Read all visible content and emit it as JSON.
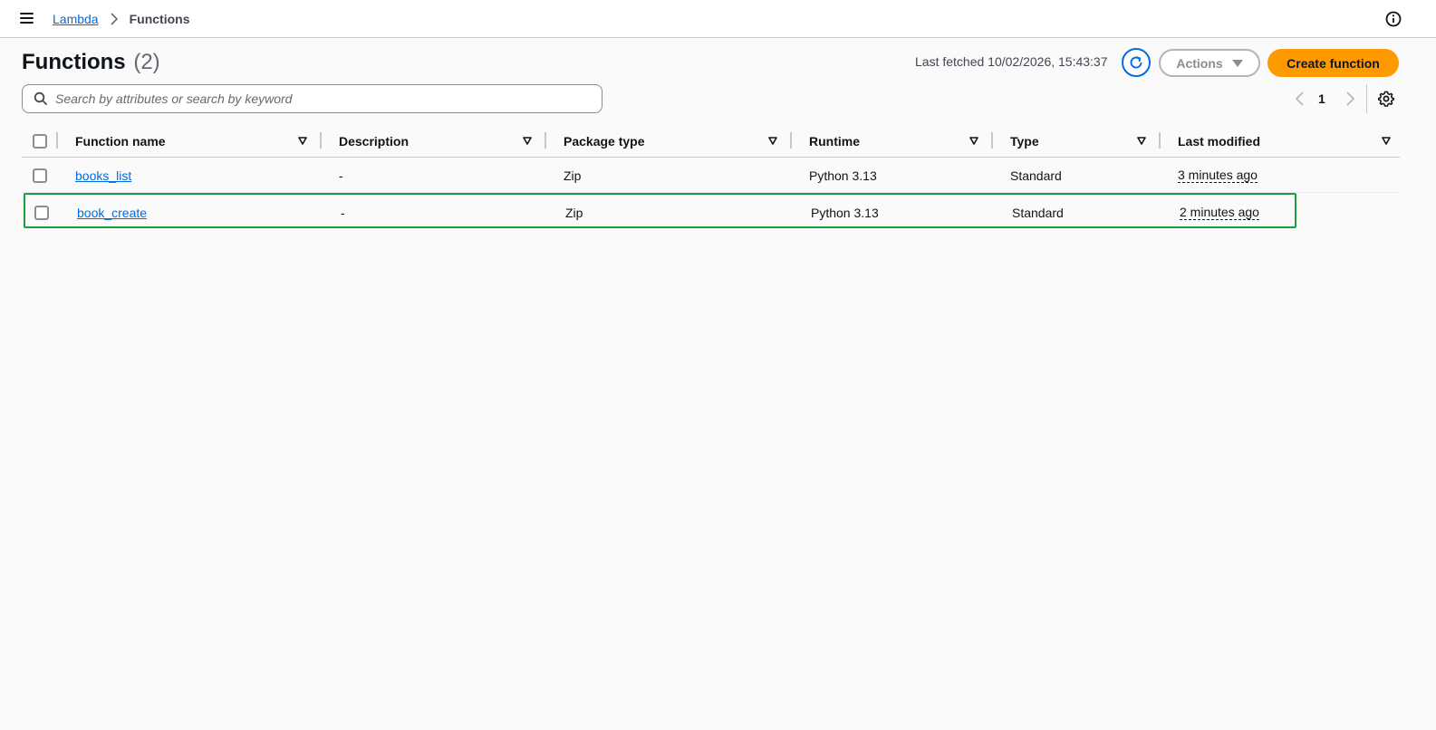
{
  "breadcrumb": {
    "parent": "Lambda",
    "current": "Functions"
  },
  "header": {
    "title": "Functions",
    "count": "(2)",
    "last_fetched": "Last fetched 10/02/2026, 15:43:37",
    "actions_label": "Actions",
    "create_label": "Create function"
  },
  "search": {
    "placeholder": "Search by attributes or search by keyword",
    "value": ""
  },
  "pagination": {
    "current_page": "1"
  },
  "table": {
    "columns": [
      "Function name",
      "Description",
      "Package type",
      "Runtime",
      "Type",
      "Last modified"
    ],
    "rows": [
      {
        "function_name": "books_list",
        "description": "-",
        "package_type": "Zip",
        "runtime": "Python 3.13",
        "type": "Standard",
        "last_modified": "3 minutes ago"
      },
      {
        "function_name": "book_create",
        "description": "-",
        "package_type": "Zip",
        "runtime": "Python 3.13",
        "type": "Standard",
        "last_modified": "2 minutes ago"
      }
    ]
  },
  "colors": {
    "link": "#006ce0",
    "primary_button": "#ff9900",
    "highlight_border": "#1b9e3e"
  },
  "icons": [
    "menu-icon",
    "chevron-right-icon",
    "info-icon",
    "refresh-icon",
    "caret-down-icon",
    "search-icon",
    "chevron-left-icon",
    "settings-icon",
    "sort-icon"
  ]
}
